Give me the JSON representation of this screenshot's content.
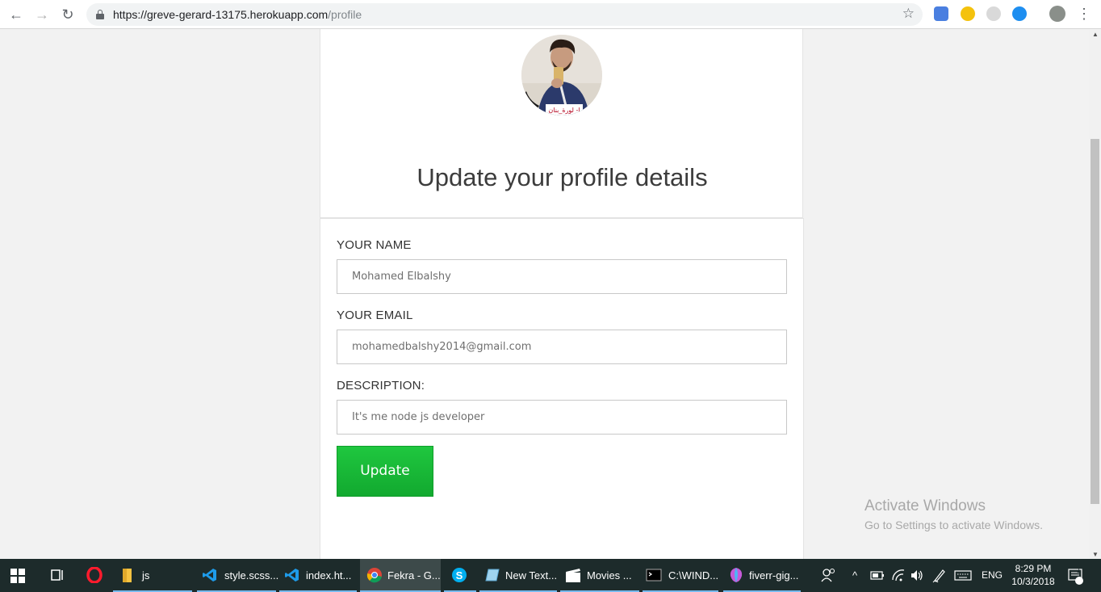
{
  "browser": {
    "url_host": "https://greve-gerard-13175.herokuapp.com",
    "url_path": "/profile"
  },
  "page": {
    "heading": "Update your profile details",
    "form": {
      "name_label": "YOUR NAME",
      "name_placeholder": "Mohamed Elbalshy",
      "email_label": "YOUR EMAIL",
      "email_placeholder": "mohamedbalshy2014@gmail.com",
      "description_label": "DESCRIPTION:",
      "description_placeholder": "It's me node js developer",
      "update_label": "Update"
    },
    "avatar_caption": "ا- لورة_بنان"
  },
  "watermark": {
    "title": "Activate Windows",
    "subtitle": "Go to Settings to activate Windows."
  },
  "taskbar": {
    "items": [
      {
        "label": "js",
        "icon": "folder-icon"
      },
      {
        "label": "style.scss...",
        "icon": "vscode-icon"
      },
      {
        "label": "index.ht...",
        "icon": "vscode-icon"
      },
      {
        "label": "Fekra - G...",
        "icon": "chrome-icon"
      },
      {
        "label": "New Text...",
        "icon": "notepad-icon"
      },
      {
        "label": "Movies ...",
        "icon": "movies-icon"
      },
      {
        "label": "C:\\WIND...",
        "icon": "cmd-icon"
      },
      {
        "label": "fiverr-gig...",
        "icon": "paint-icon"
      }
    ],
    "language": "ENG",
    "time": "8:29 PM",
    "date": "10/3/2018",
    "notification_count": "1"
  },
  "colors": {
    "update_button": "#1cbe3b",
    "taskbar": "#1d2b2b",
    "accent_underline": "#76b9ed"
  }
}
